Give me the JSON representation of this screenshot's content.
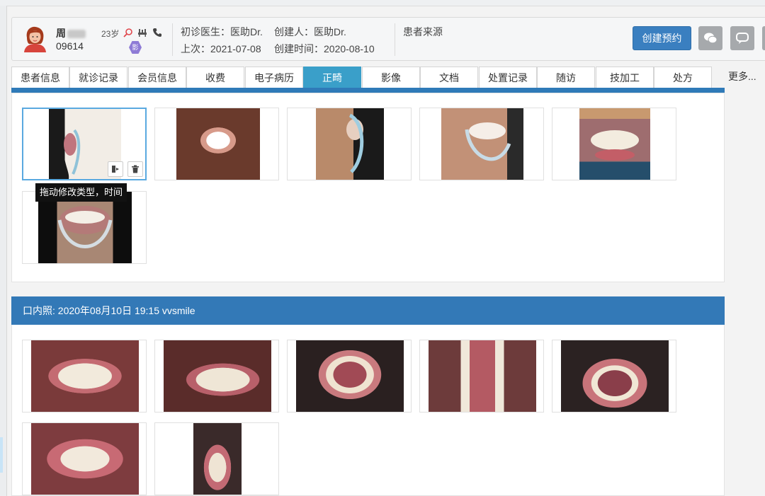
{
  "patient": {
    "name": "周",
    "id": "09614",
    "age": "23岁",
    "badge": "影"
  },
  "info": {
    "first_doctor": "初诊医生：医助Dr.",
    "creator": "创建人：医助Dr.",
    "patient_source": "患者来源",
    "last_visit": "上次：2021-07-08",
    "created_time": "创建时间：2020-08-10"
  },
  "actions": {
    "create_appointment": "创建预约",
    "wechat_icon": "wechat-icon",
    "message_icon": "message-icon"
  },
  "tabs": [
    {
      "label": "患者信息",
      "active": false
    },
    {
      "label": "就诊记录",
      "active": false
    },
    {
      "label": "会员信息",
      "active": false
    },
    {
      "label": "收费",
      "active": false
    },
    {
      "label": "电子病历",
      "active": false
    },
    {
      "label": "正畸",
      "active": true
    },
    {
      "label": "影像",
      "active": false
    },
    {
      "label": "文档",
      "active": false
    },
    {
      "label": "处置记录",
      "active": false
    },
    {
      "label": "随访",
      "active": false
    },
    {
      "label": "技加工",
      "active": false
    },
    {
      "label": "处方",
      "active": false
    }
  ],
  "more_label": "更多...",
  "tooltip": "拖动修改类型，时间",
  "section2": {
    "title": "口内照:   2020年08月10日 19:15 vvsmile"
  },
  "colors": {
    "accent_blue": "#3379b7",
    "active_tab": "#3a9fc9",
    "appointment_button": "#3a7fc0"
  }
}
